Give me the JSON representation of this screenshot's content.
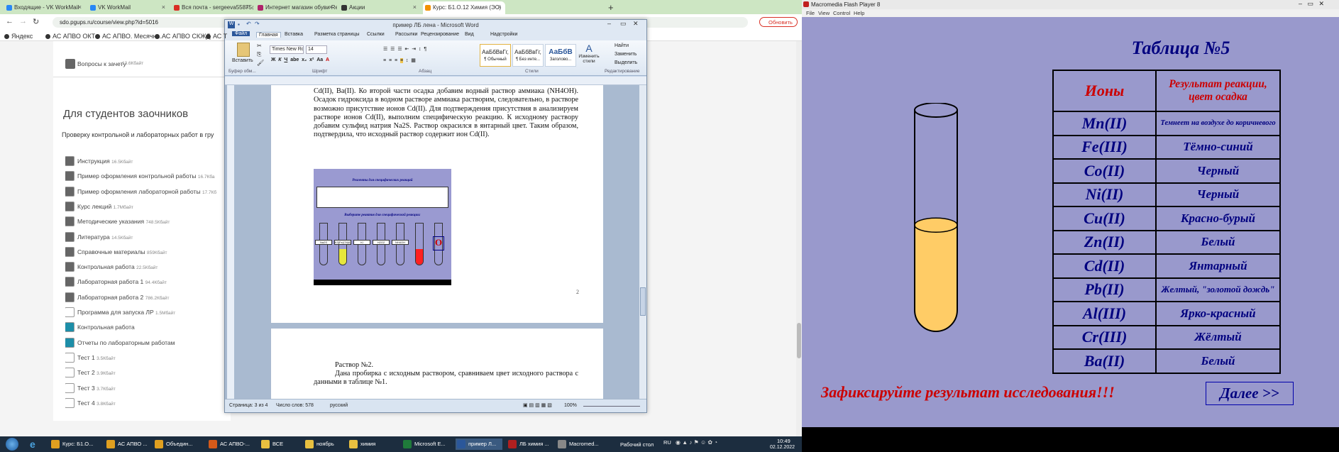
{
  "browser": {
    "tabs": [
      {
        "title": "Входящие - VK WorkMail",
        "color": "#2787f5"
      },
      {
        "title": "VK WorkMail",
        "color": "#2787f5"
      },
      {
        "title": "Вся почта - sergeeva55875@gm",
        "color": "#d93025"
      },
      {
        "title": "Интернет магазин обуви Rendez",
        "color": "#b0236a"
      },
      {
        "title": "Акции",
        "color": "#333333"
      },
      {
        "title": "Курс: Б1.О.12 Химия (ЭС)",
        "color": "#f29100"
      }
    ],
    "url": "sdo.pgups.ru/course/view.php?id=5016",
    "bookmarks": [
      "Яндекс",
      "АС АПВО ОКТ",
      "АС АПВО. Месячн...",
      "АС АПВО СКЖД",
      "АС Т"
    ],
    "update_button": "Обновить",
    "top_resource": {
      "name": "Вопросы к зачету",
      "size": "13.6Кбайт"
    },
    "section_title": "Для студентов заочников",
    "section_desc": "Проверку контрольной и лабораторных работ в гру",
    "resources": [
      {
        "name": "Инструкция",
        "size": "16.5Кбайт",
        "color": "#666666"
      },
      {
        "name": "Пример оформления контрольной работы",
        "size": "16.7Кба",
        "color": "#666666"
      },
      {
        "name": "Пример оформления лабораторной работы",
        "size": "17.7Кб",
        "color": "#666666"
      },
      {
        "name": "Курс лекций",
        "size": "1.7Мбайт",
        "color": "#666666"
      },
      {
        "name": "Методические указания",
        "size": "748.5Кбайт",
        "color": "#666666"
      },
      {
        "name": "Литература",
        "size": "14.5Кбайт",
        "color": "#666666"
      },
      {
        "name": "Справочные материалы",
        "size": "859Кбайт",
        "color": "#666666"
      },
      {
        "name": "Контрольная работа",
        "size": "22.5Кбайт",
        "color": "#666666"
      },
      {
        "name": "Лабораторная работа 1",
        "size": "94.4Кбайт",
        "color": "#666666"
      },
      {
        "name": "Лабораторная работа 2",
        "size": "786.2Кбайт",
        "color": "#666666"
      },
      {
        "name": "Программа для запуска ЛР",
        "size": "1.5Мбайт",
        "color": "#ffffff"
      },
      {
        "name": "Контрольная работа",
        "size": "",
        "color": "#1d8ea8"
      },
      {
        "name": "Отчеты по лабораторным работам",
        "size": "",
        "color": "#1d8ea8"
      },
      {
        "name": "Тест 1",
        "size": "3.5Кбайт",
        "color": "#ffffff"
      },
      {
        "name": "Тест 2",
        "size": "3.9Кбайт",
        "color": "#ffffff"
      },
      {
        "name": "Тест 3",
        "size": "3.7Кбайт",
        "color": "#ffffff"
      },
      {
        "name": "Тест 4",
        "size": "3.8Кбайт",
        "color": "#ffffff"
      }
    ]
  },
  "word": {
    "title": "пример ЛБ лена - Microsoft Word",
    "ribbon_tabs": [
      "Файл",
      "Главная",
      "Вставка",
      "Разметка страницы",
      "Ссылки",
      "Рассылки",
      "Рецензирование",
      "Вид",
      "Надстройки"
    ],
    "font_name": "Times New Ro",
    "font_size": "14",
    "paste_label": "Вставить",
    "styles": [
      {
        "sample": "АаБбВвГг,",
        "name": "¶ Обычный"
      },
      {
        "sample": "АаБбВвГг,",
        "name": "¶ Без инте..."
      },
      {
        "sample": "АаБбВ",
        "name": "Заголово..."
      }
    ],
    "change_styles": "Изменить стили",
    "editing": [
      "Найти",
      "Заменить",
      "Выделить"
    ],
    "groups": [
      "Буфер обм...",
      "Шрифт",
      "Абзац",
      "Стили",
      "Редактирование"
    ],
    "page1_text": "Cd(II), Ba(II). Ко второй части осадка добавим водный раствор аммиака (NH4OH). Осадок гидроксида в водном растворе аммиака растворим, следовательно, в растворе возможно присутствие ионов Cd(II). Для подтверждения присутствия в анализируем растворе ионов Cd(II), выполним специфическую реакцию. К исходному раствору добавим сульфид натрия Na2S. Раствор окрасился в янтарный цвет. Таким образом, подтвердила, что исходный раствор содержит ион Cd(II).",
    "page_number": "2",
    "page2_heading": "Раствор №2.",
    "page2_text": "Дана пробирка с исходным раствором, сравниваем цвет исходного раствора с данными в таблице №1.",
    "status_page": "Страница: 3 из 4",
    "status_words": "Число слов: 578",
    "status_lang": "русский",
    "zoom": "100%"
  },
  "embedded": {
    "title": "Реагенты для специфических реакций",
    "subtitle": "Выберите реактив для специфической реакции:",
    "reagents": [
      "Na2S",
      "K3[Fe(CN)6]",
      "KI",
      "H2O2",
      "NH4OH",
      "",
      ""
    ],
    "answer": "O"
  },
  "taskbar": {
    "items": [
      {
        "label": "Курс: Б1.О...",
        "color": "#e0a020"
      },
      {
        "label": "АС АПВО ...",
        "color": "#e0a020"
      },
      {
        "label": "Объедин...",
        "color": "#e0a020"
      },
      {
        "label": "АС АПВО-...",
        "color": "#d45a1a"
      },
      {
        "label": "ВСЕ",
        "color": "#e8c040"
      },
      {
        "label": "ноябрь",
        "color": "#e8c040"
      },
      {
        "label": "химия",
        "color": "#e8c040"
      },
      {
        "label": "Microsoft E...",
        "color": "#1f7a3a"
      },
      {
        "label": "пример Л...",
        "color": "#2b579a"
      },
      {
        "label": "ЛБ химия ...",
        "color": "#b02020"
      },
      {
        "label": "Macromed...",
        "color": "#888888"
      }
    ],
    "desktop": "Рабочий стол",
    "lang": "RU",
    "time": "10:49",
    "date": "02.12.2022"
  },
  "flash": {
    "window_title": "Macromedia Flash Player 8",
    "menu": [
      "File",
      "View",
      "Control",
      "Help"
    ],
    "table_title": "Таблица №5",
    "col_ions": "Ионы",
    "col_result": "Результат реакции, цвет осадка",
    "rows": [
      {
        "ion": "Mn(II)",
        "result": "Темнеет на воздухе до коричневого"
      },
      {
        "ion": "Fe(III)",
        "result": "Тёмно-синий"
      },
      {
        "ion": "Co(II)",
        "result": "Черный"
      },
      {
        "ion": "Ni(II)",
        "result": "Черный"
      },
      {
        "ion": "Cu(II)",
        "result": "Красно-бурый"
      },
      {
        "ion": "Zn(II)",
        "result": "Белый"
      },
      {
        "ion": "Cd(II)",
        "result": "Янтарный"
      },
      {
        "ion": "Pb(II)",
        "result": "Желтый, \"золотой дождь\""
      },
      {
        "ion": "Al(III)",
        "result": "Ярко-красный"
      },
      {
        "ion": "Cr(III)",
        "result": "Жёлтый"
      },
      {
        "ion": "Ba(II)",
        "result": "Белый"
      }
    ],
    "message": "Зафиксируйте результат исследования!!!",
    "next_button": "Далее >>",
    "tube_fill_fraction": 0.48,
    "tube_color": "#ffcc66"
  }
}
